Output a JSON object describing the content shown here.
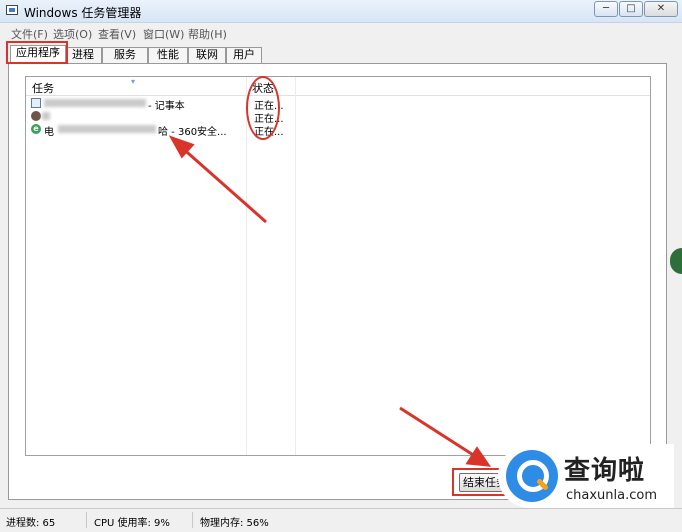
{
  "window": {
    "title": "Windows 任务管理器",
    "controls": {
      "minimize": "─",
      "maximize": "□",
      "close": "✕"
    }
  },
  "menu": [
    "文件(F)",
    "选项(O)",
    "查看(V)",
    "窗口(W)",
    "帮助(H)"
  ],
  "tabs": [
    "应用程序",
    "进程",
    "服务",
    "性能",
    "联网",
    "用户"
  ],
  "active_tab": "应用程序",
  "list": {
    "columns": {
      "task": "任务",
      "status": "状态"
    },
    "rows": [
      {
        "icon": "notepad-icon",
        "prefix": "",
        "suffix": " - 记事本",
        "status": "正在..."
      },
      {
        "icon": "avatar-icon",
        "prefix": "",
        "suffix": "",
        "status": "正在..."
      },
      {
        "icon": "browser-360-icon",
        "prefix": "电",
        "suffix": "哈 - 360安全...",
        "status": "正在..."
      }
    ]
  },
  "buttons": {
    "end_task": "结束任务"
  },
  "statusbar": {
    "processes": "进程数: 65",
    "cpu": "CPU 使用率: 9%",
    "memory": "物理内存: 56%"
  },
  "watermark": {
    "cn": "查询啦",
    "en": "chaxunla.com"
  },
  "annotation_color": "#d9342a"
}
